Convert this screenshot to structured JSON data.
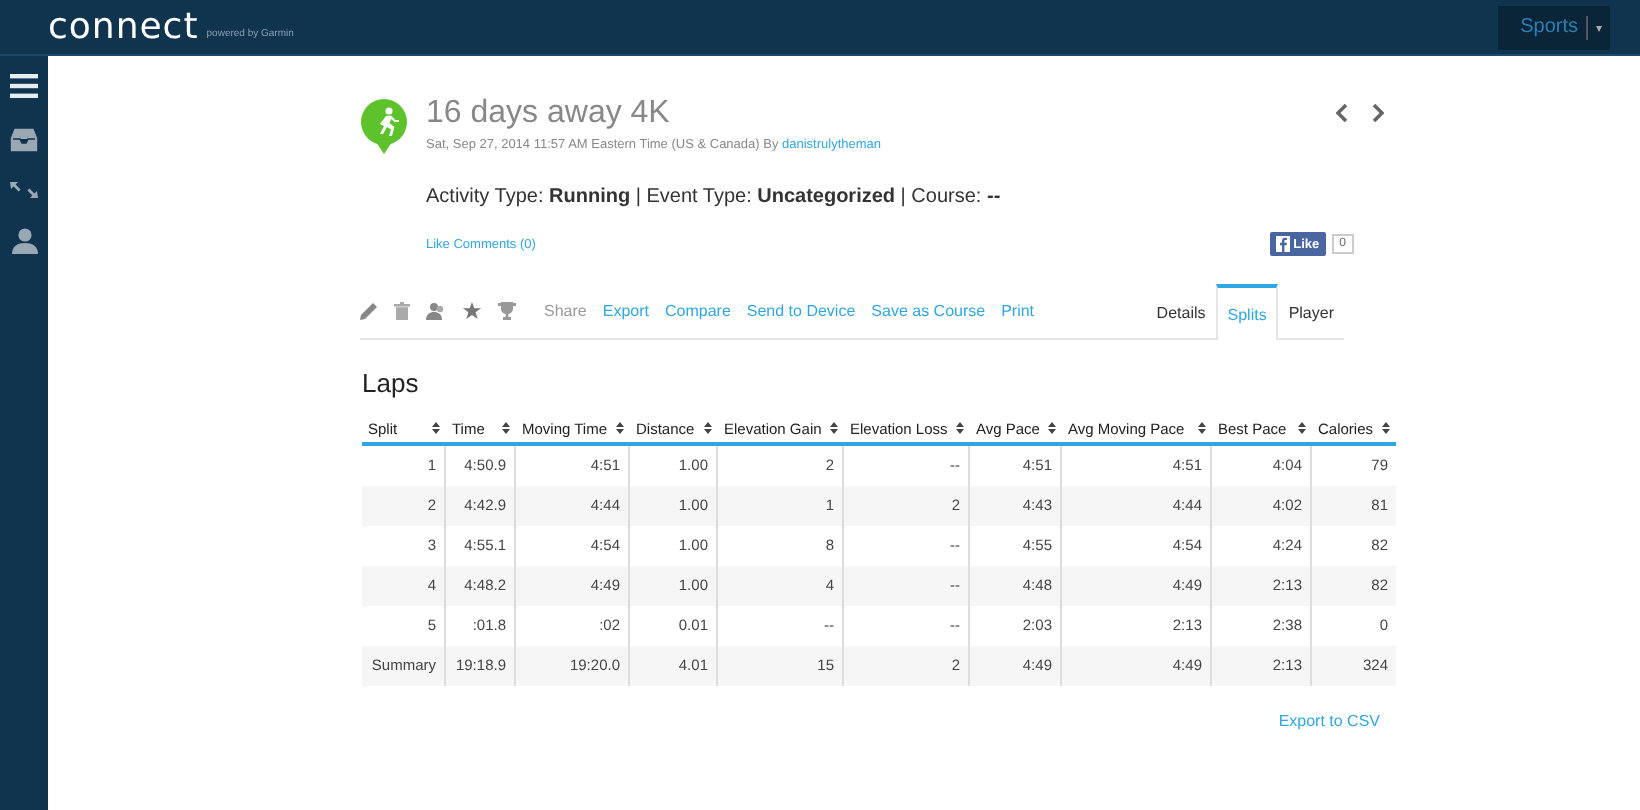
{
  "topbar": {
    "logo": "connect",
    "tagline": "powered by Garmin",
    "menu": {
      "label": "Sports",
      "caret": "▾"
    }
  },
  "activity": {
    "title": "16 days away 4K",
    "date": "Sat, Sep 27, 2014 11:57 AM Eastern Time (US & Canada) By",
    "author": "danistrulytheman",
    "info": "Activity Type: **Running** | Event Type: **Uncategorized** | Course: **--**",
    "social": "Like Comments (0)",
    "fb_like": "Like",
    "fb_count": "0"
  },
  "actions": [
    {
      "label": "Share",
      "disabled": true
    },
    {
      "label": "Export",
      "disabled": false
    },
    {
      "label": "Compare",
      "disabled": false
    },
    {
      "label": "Send to Device",
      "disabled": false
    },
    {
      "label": "Save as Course",
      "disabled": false
    },
    {
      "label": "Print",
      "disabled": false
    }
  ],
  "tabs": [
    {
      "label": "Details",
      "selected": false
    },
    {
      "label": "Splits",
      "selected": true
    },
    {
      "label": "Player",
      "selected": false
    }
  ],
  "laps": {
    "title": "Laps",
    "columns": [
      "Split",
      "Time",
      "Moving Time",
      "Distance",
      "Elevation Gain",
      "Elevation Loss",
      "Avg Pace",
      "Avg Moving Pace",
      "Best Pace",
      "Calories"
    ],
    "rows": [
      [
        "1",
        "4:50.9",
        "4:51",
        "1.00",
        "2",
        "--",
        "4:51",
        "4:51",
        "4:04",
        "79"
      ],
      [
        "2",
        "4:42.9",
        "4:44",
        "1.00",
        "1",
        "2",
        "4:43",
        "4:44",
        "4:02",
        "81"
      ],
      [
        "3",
        "4:55.1",
        "4:54",
        "1.00",
        "8",
        "--",
        "4:55",
        "4:54",
        "4:24",
        "82"
      ],
      [
        "4",
        "4:48.2",
        "4:49",
        "1.00",
        "4",
        "--",
        "4:48",
        "4:49",
        "2:13",
        "82"
      ],
      [
        "5",
        ":01.8",
        ":02",
        "0.01",
        "--",
        "--",
        "2:03",
        "2:13",
        "2:38",
        "0"
      ],
      [
        "Summary",
        "19:18.9",
        "19:20.0",
        "4.01",
        "15",
        "2",
        "4:49",
        "4:49",
        "2:13",
        "324"
      ]
    ],
    "export": "Export to CSV"
  }
}
